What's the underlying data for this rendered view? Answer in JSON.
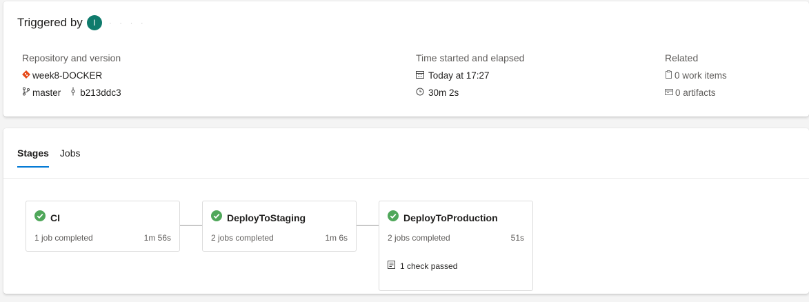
{
  "summary": {
    "triggered_label": "Triggered by",
    "avatar_initial": "I",
    "username": "·  ·  ·  ·",
    "repository": {
      "label": "Repository and version",
      "repo_name": "week8-DOCKER",
      "branch": "master",
      "commit": "b213ddc3"
    },
    "time": {
      "label": "Time started and elapsed",
      "started": "Today at 17:27",
      "elapsed": "30m 2s"
    },
    "related": {
      "label": "Related",
      "work_items": "0 work items",
      "artifacts": "0 artifacts"
    }
  },
  "tabs": [
    {
      "label": "Stages",
      "active": true
    },
    {
      "label": "Jobs",
      "active": false
    }
  ],
  "stages": [
    {
      "name": "CI",
      "jobs": "1 job completed",
      "duration": "1m 56s",
      "status": "succeeded"
    },
    {
      "name": "DeployToStaging",
      "jobs": "2 jobs completed",
      "duration": "1m 6s",
      "status": "succeeded"
    },
    {
      "name": "DeployToProduction",
      "jobs": "2 jobs completed",
      "duration": "51s",
      "status": "succeeded",
      "check": "1 check passed"
    }
  ],
  "colors": {
    "success": "#4fa75a",
    "repo_icon": "#e64a19",
    "accent": "#0078d4",
    "avatar": "#0f7b6c"
  }
}
